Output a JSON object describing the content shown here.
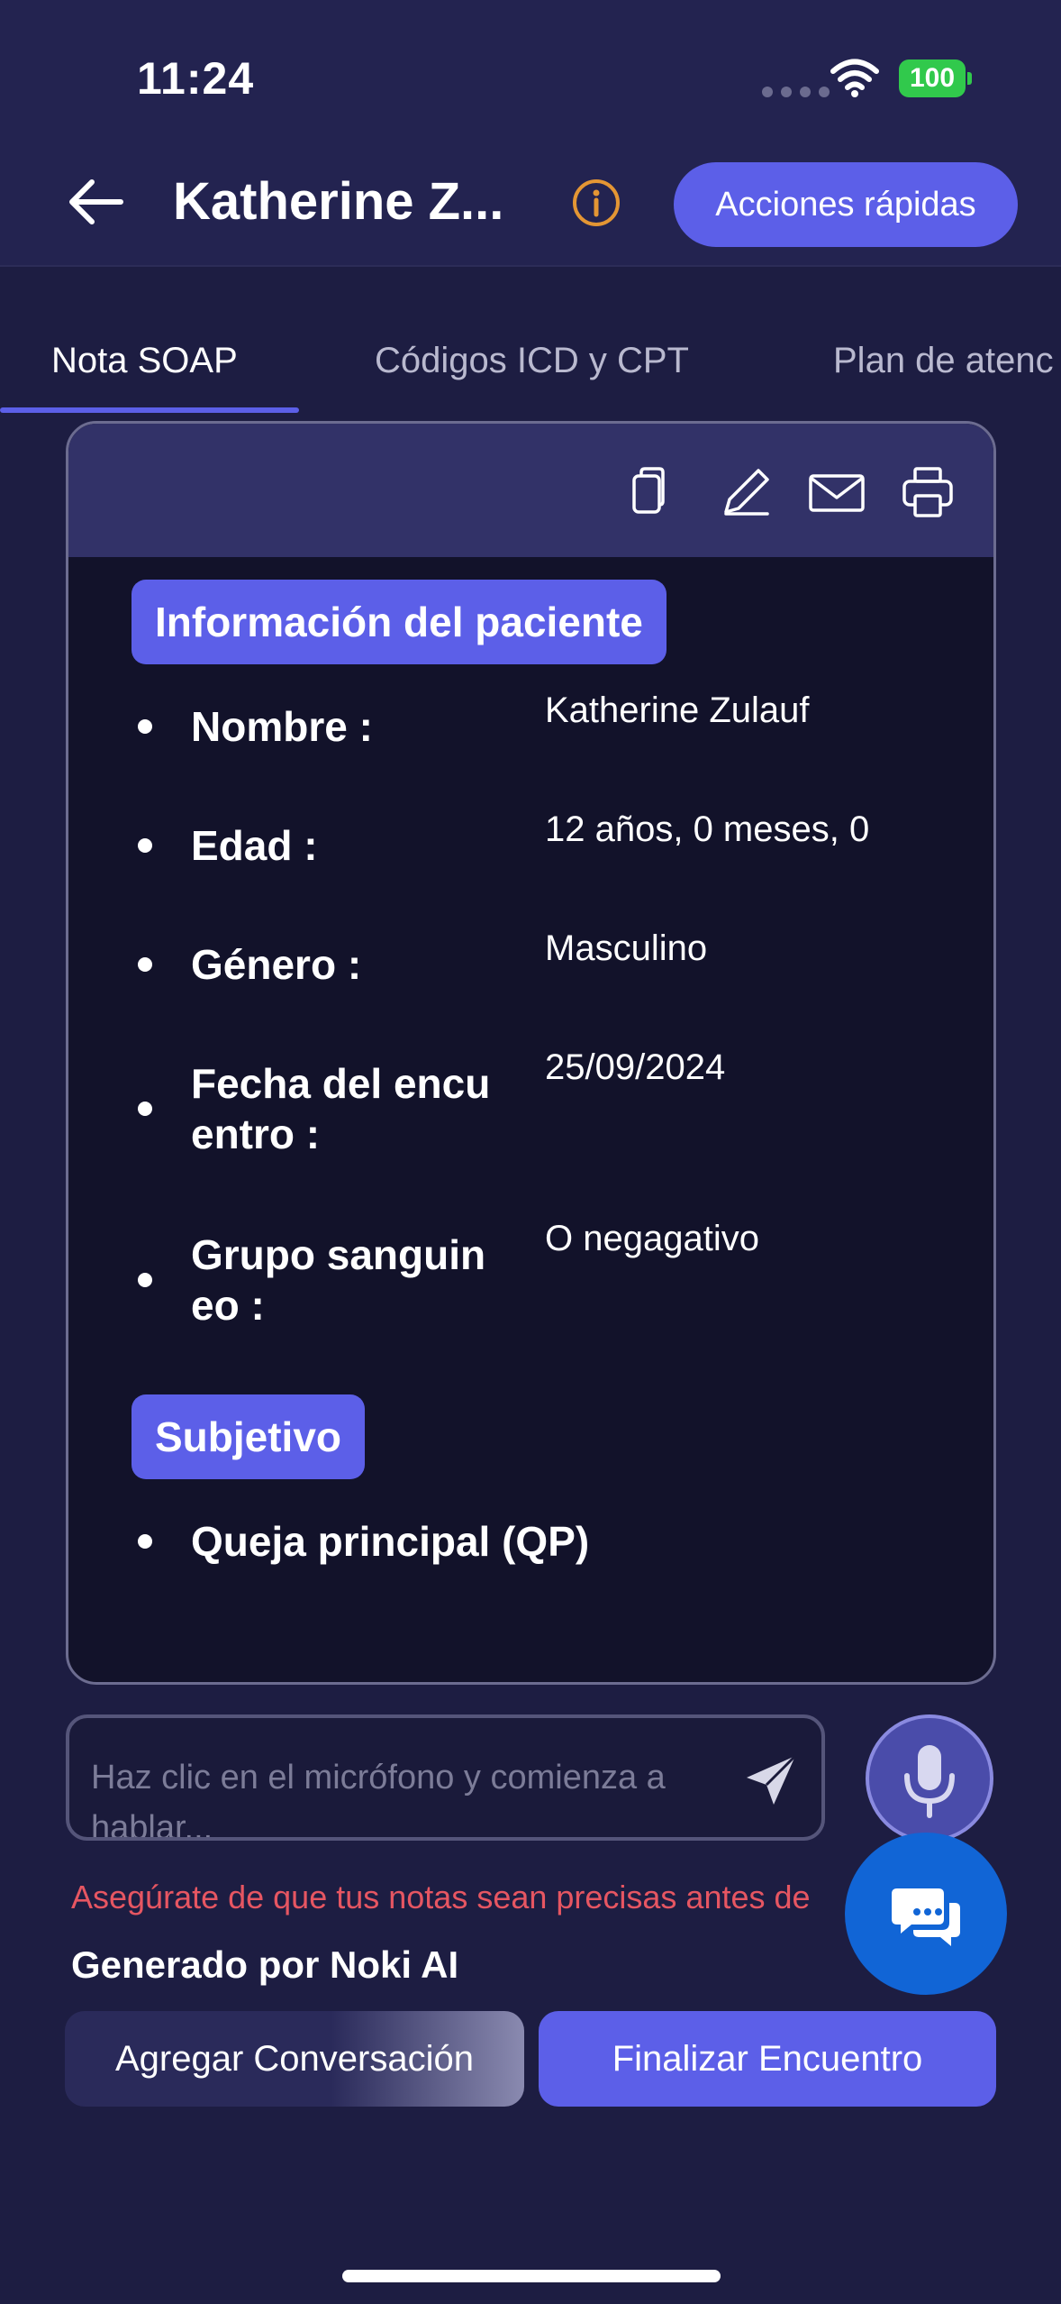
{
  "status_bar": {
    "time": "11:24",
    "battery": "100"
  },
  "header": {
    "title": "Katherine Z...",
    "quick_actions_label": "Acciones rápidas"
  },
  "tabs": [
    {
      "label": "Nota SOAP",
      "active": true
    },
    {
      "label": "Códigos ICD y CPT",
      "active": false
    },
    {
      "label": "Plan de atenc",
      "active": false
    }
  ],
  "card": {
    "toolbar_icons": [
      "copy-icon",
      "edit-icon",
      "mail-icon",
      "print-icon"
    ],
    "patient_section_title": "Información del paciente",
    "patient_fields": [
      {
        "label": "Nombre :",
        "value": "Katherine Zulauf"
      },
      {
        "label": "Edad :",
        "value": "12 años, 0 meses, 0"
      },
      {
        "label": "Género :",
        "value": "Masculino"
      },
      {
        "label": "Fecha del encu entro :",
        "value": "25/09/2024"
      },
      {
        "label": "Grupo sanguin eo :",
        "value": "O negagativo"
      }
    ],
    "subjective_section_title": "Subjetivo",
    "subjective_items": [
      "Queja principal (QP)"
    ]
  },
  "input": {
    "placeholder": "Haz clic en el micrófono y comienza a hablar..."
  },
  "warning_text": "Asegúrate de que tus notas sean precisas antes de",
  "generated_by": "Generado por Noki AI",
  "buttons": {
    "add_conversation": "Agregar Conversación",
    "finish_encounter": "Finalizar Encuentro"
  },
  "colors": {
    "background": "#1d1d42",
    "accent": "#5c5fe8",
    "warning": "#e65662",
    "fab": "#1165d6",
    "battery": "#31c94c"
  }
}
